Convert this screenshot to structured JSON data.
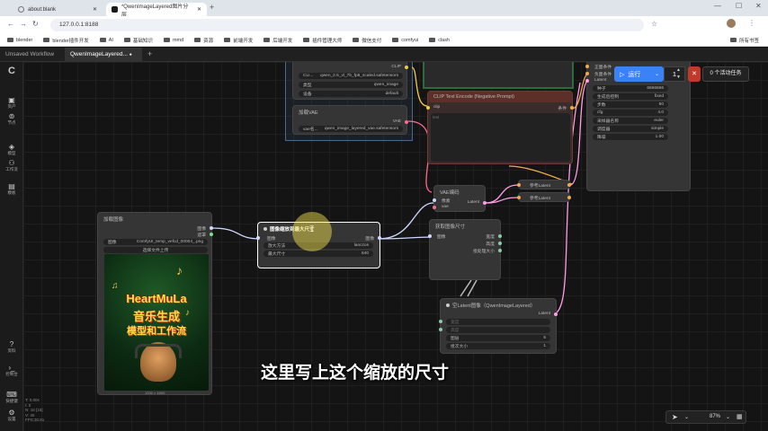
{
  "browser": {
    "tabs": [
      {
        "label": "about:blank"
      },
      {
        "label": "*QwenImageLayered图片分层"
      }
    ],
    "url": "127.0.0.1:8188",
    "bookmarks": [
      "blender",
      "blender插件开发",
      "AI",
      "基础知识",
      "mmd",
      "资源",
      "前端开发",
      "后端开发",
      "插件管理大师",
      "微信支付",
      "comfyui",
      "clash"
    ],
    "bookmarks_right": "所有书签"
  },
  "app": {
    "tabs": [
      {
        "label": "Unsaved Workflow"
      },
      {
        "label": "QwenImageLayered..."
      }
    ],
    "add_tab": "+",
    "sidebar": [
      {
        "label": "资产",
        "icon": "images-icon"
      },
      {
        "label": "节点",
        "icon": "node-library-icon"
      },
      {
        "label": "模型",
        "icon": "model-library-icon"
      },
      {
        "label": "工作流",
        "icon": "workflows-icon"
      },
      {
        "label": "模板",
        "icon": "templates-icon"
      },
      {
        "label": "资料",
        "icon": "help-icon"
      },
      {
        "label": "控制台",
        "icon": "console-icon"
      },
      {
        "label": "快捷键",
        "icon": "keyboard-icon"
      },
      {
        "label": "设置",
        "icon": "settings-icon"
      }
    ],
    "run": {
      "label": "运行",
      "count": "1",
      "queue": "0 个活动任务"
    },
    "zoom": "87%",
    "stats": [
      "T: 0.00s",
      "I: 0",
      "N: 18 [15]",
      "V: 40",
      "FPS:30.81"
    ]
  },
  "nodes": {
    "clip_loader": {
      "clip_out": "CLIP",
      "clip_name": "qwen_2.5_vl_7b_fp8_scaled.safetensors",
      "clip_label": "CLI...",
      "type_label": "类型",
      "type_value": "qwen_image",
      "device_label": "设备",
      "device_value": "default"
    },
    "vae_loader": {
      "title": "加载VAE",
      "vae_out": "VAE",
      "vae_label": "vae名...",
      "vae_value": "qwen_image_layered_vae.safetensors"
    },
    "clip_neg": {
      "title": "CLIP Text Encode (Negative Prompt)",
      "in_clip": "clip",
      "out_cond": "条件",
      "text": "text"
    },
    "sampler": {
      "rows": [
        {
          "label": "种子",
          "value": "6666666"
        },
        {
          "label": "生成后控制",
          "value": "fixed"
        },
        {
          "label": "步数",
          "value": "50"
        },
        {
          "label": "cfg",
          "value": "4.0"
        },
        {
          "label": "采样器名称",
          "value": "euler"
        },
        {
          "label": "调度器",
          "value": "simple"
        },
        {
          "label": "降噪",
          "value": "1.00"
        }
      ],
      "inputs": [
        "正面条件",
        "负面条件",
        "Latent"
      ]
    },
    "load_image": {
      "title": "加载图像",
      "out_image": "图像",
      "out_mask": "遮罩",
      "image_label": "图像",
      "image_value": "ComfyUI_temp_vefcd_00004_.png",
      "upload": "选择文件上传",
      "poster_line1": "HeartMuLa",
      "poster_line2": "音乐生成",
      "poster_line3": "模型和工作流",
      "size": "1200 × 1600"
    },
    "scale": {
      "title": "图像缩放到最大尺寸",
      "in_image": "图像",
      "out_image": "图像",
      "method_label": "放大方法",
      "method_value": "lanczos",
      "max_label": "最大尺寸",
      "max_value": "640"
    },
    "vae_encode": {
      "title": "VAE编码",
      "in_pixels": "像素",
      "in_vae": "vae",
      "out_latent": "Latent"
    },
    "ref1": {
      "label": "参考Latent"
    },
    "ref2": {
      "label": "参考Latent"
    },
    "get_size": {
      "title": "获取图像尺寸",
      "in_image": "图像",
      "out_width": "宽度",
      "out_height": "高度",
      "out_batch": "批处理大小"
    },
    "empty_latent": {
      "title": "空Latent图像（QwenImageLayered）",
      "out_latent": "Latent",
      "width": "宽度",
      "height": "高度",
      "layers_label": "图层",
      "layers_value": "5",
      "batch_label": "批次大小",
      "batch_value": "1"
    }
  },
  "subtitle": "这里写上这个缩放的尺寸"
}
